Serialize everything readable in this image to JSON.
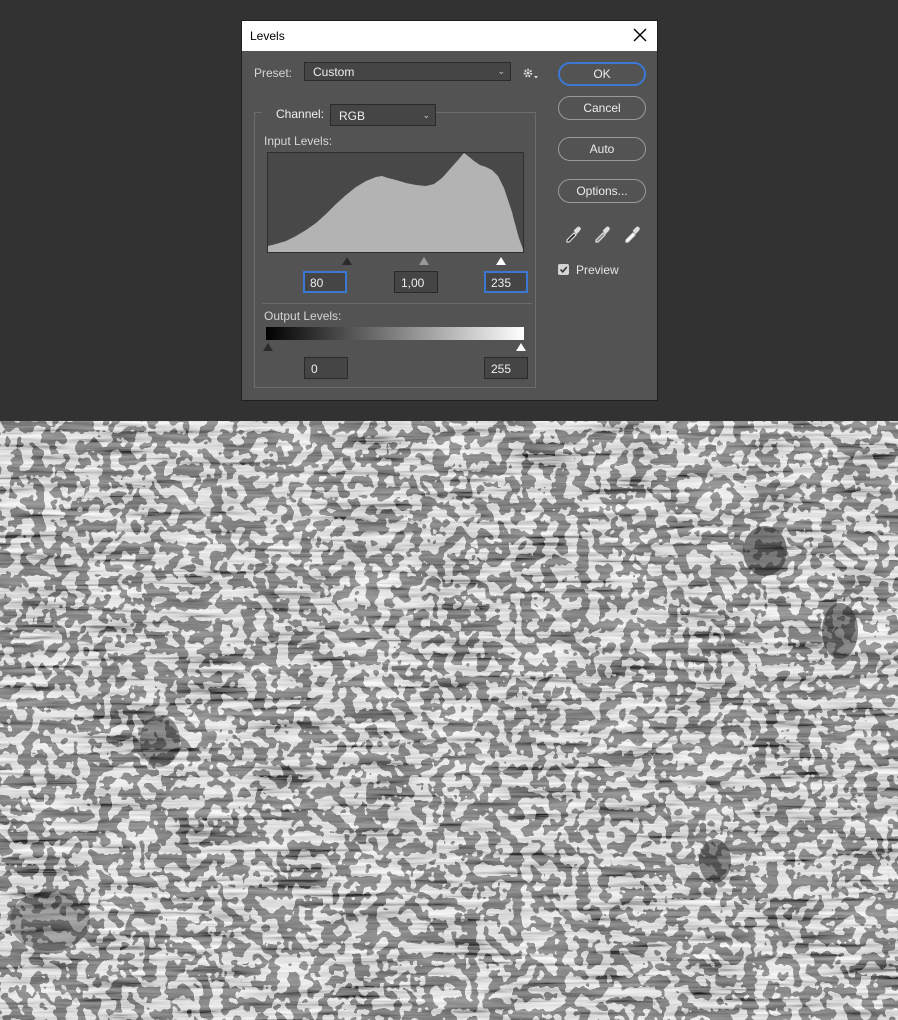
{
  "dialog": {
    "title": "Levels",
    "preset_label": "Preset:",
    "preset_value": "Custom",
    "channel_label": "Channel:",
    "channel_value": "RGB",
    "input_levels_label": "Input Levels:",
    "input_black": "80",
    "input_gamma": "1,00",
    "input_white": "235",
    "output_levels_label": "Output Levels:",
    "output_black": "0",
    "output_white": "255",
    "buttons": {
      "ok": "OK",
      "cancel": "Cancel",
      "auto": "Auto",
      "options": "Options..."
    },
    "preview_label": "Preview",
    "preview_checked": true
  },
  "icons": [
    "close-icon",
    "gear-icon",
    "chevron-down-icon",
    "black-eyedropper-icon",
    "gray-eyedropper-icon",
    "white-eyedropper-icon",
    "checkbox-check-icon"
  ],
  "colors": {
    "accent": "#3b78d4",
    "panel": "#535353",
    "canvas_bg": "#323232"
  }
}
